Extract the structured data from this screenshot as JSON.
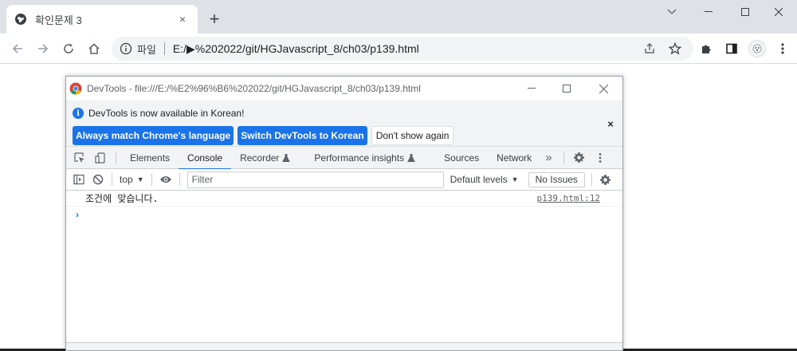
{
  "browser": {
    "tab_title": "확인문제 3",
    "tab_close": "×",
    "new_tab": "+",
    "omnibox": {
      "file_label": "파일",
      "url": "E:/▶%202022/git/HGJavascript_8/ch03/p139.html"
    },
    "colors": {
      "tabstrip": "#dee1e6",
      "accent": "#1a73e8"
    }
  },
  "devtools": {
    "title": "DevTools - file:///E:/%E2%96%B6%202022/git/HGJavascript_8/ch03/p139.html",
    "infobar": {
      "message": "DevTools is now available in Korean!",
      "btn_match": "Always match Chrome's language",
      "btn_switch": "Switch DevTools to Korean",
      "btn_dont_show": "Don't show again",
      "close": "×"
    },
    "tabs": [
      {
        "label": "Elements"
      },
      {
        "label": "Console"
      },
      {
        "label": "Recorder"
      },
      {
        "label": "Performance insights"
      },
      {
        "label": "Sources"
      },
      {
        "label": "Network"
      }
    ],
    "more_tabs": "»",
    "console_toolbar": {
      "context": "top",
      "filter_placeholder": "Filter",
      "levels": "Default levels",
      "issues": "No Issues"
    },
    "console": {
      "log_message": "조건에 맞습니다.",
      "log_source": "p139.html:12",
      "prompt": "›"
    }
  }
}
